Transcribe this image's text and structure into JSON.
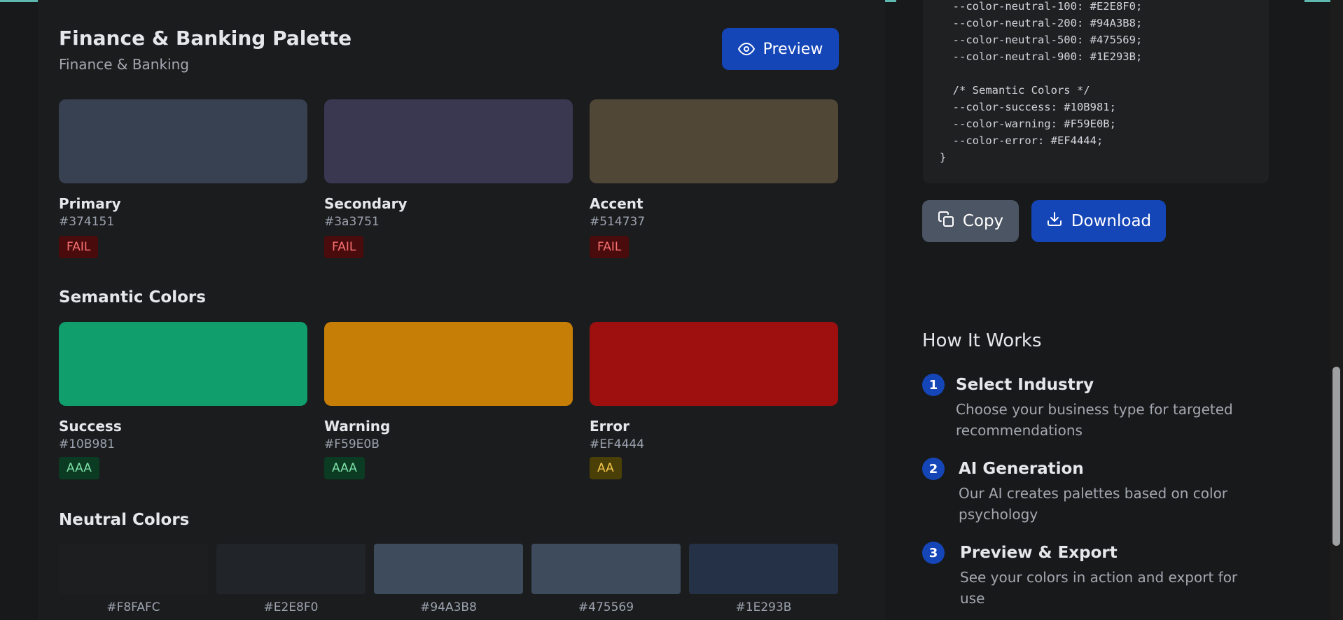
{
  "palette": {
    "title": "Finance & Banking Palette",
    "subtitle": "Finance & Banking",
    "preview_label": "Preview"
  },
  "brand": [
    {
      "name": "Primary",
      "hex": "#374151",
      "color": "#374151",
      "badge": "FAIL"
    },
    {
      "name": "Secondary",
      "hex": "#3a3751",
      "color": "#3a3751",
      "badge": "FAIL"
    },
    {
      "name": "Accent",
      "hex": "#514737",
      "color": "#514737",
      "badge": "FAIL"
    }
  ],
  "semantic": {
    "title": "Semantic Colors",
    "items": [
      {
        "name": "Success",
        "hex": "#10B981",
        "color": "#0f9e6c",
        "badge": "AAA"
      },
      {
        "name": "Warning",
        "hex": "#F59E0B",
        "color": "#c67e06",
        "badge": "AAA"
      },
      {
        "name": "Error",
        "hex": "#EF4444",
        "color": "#9e1010",
        "badge": "AA"
      }
    ]
  },
  "neutral": {
    "title": "Neutral Colors",
    "items": [
      {
        "hex": "#F8FAFC",
        "color": "#1d1e20"
      },
      {
        "hex": "#E2E8F0",
        "color": "#212428"
      },
      {
        "hex": "#94A3B8",
        "color": "#3e4b5d"
      },
      {
        "hex": "#475569",
        "color": "#3e4b5d"
      },
      {
        "hex": "#1E293B",
        "color": "#243147"
      }
    ]
  },
  "code": {
    "lines": [
      "  --color-neutral-100: #E2E8F0;",
      "  --color-neutral-200: #94A3B8;",
      "  --color-neutral-500: #475569;",
      "  --color-neutral-900: #1E293B;",
      "",
      "  /* Semantic Colors */",
      "  --color-success: #10B981;",
      "  --color-warning: #F59E0B;",
      "  --color-error: #EF4444;",
      "}"
    ],
    "copy_label": "Copy",
    "download_label": "Download"
  },
  "how": {
    "title": "How It Works",
    "steps": [
      {
        "num": "1",
        "title": "Select Industry",
        "desc": "Choose your business type for targeted recommendations"
      },
      {
        "num": "2",
        "title": "AI Generation",
        "desc": "Our AI creates palettes based on color psychology"
      },
      {
        "num": "3",
        "title": "Preview & Export",
        "desc": "See your colors in action and export for use"
      }
    ]
  }
}
